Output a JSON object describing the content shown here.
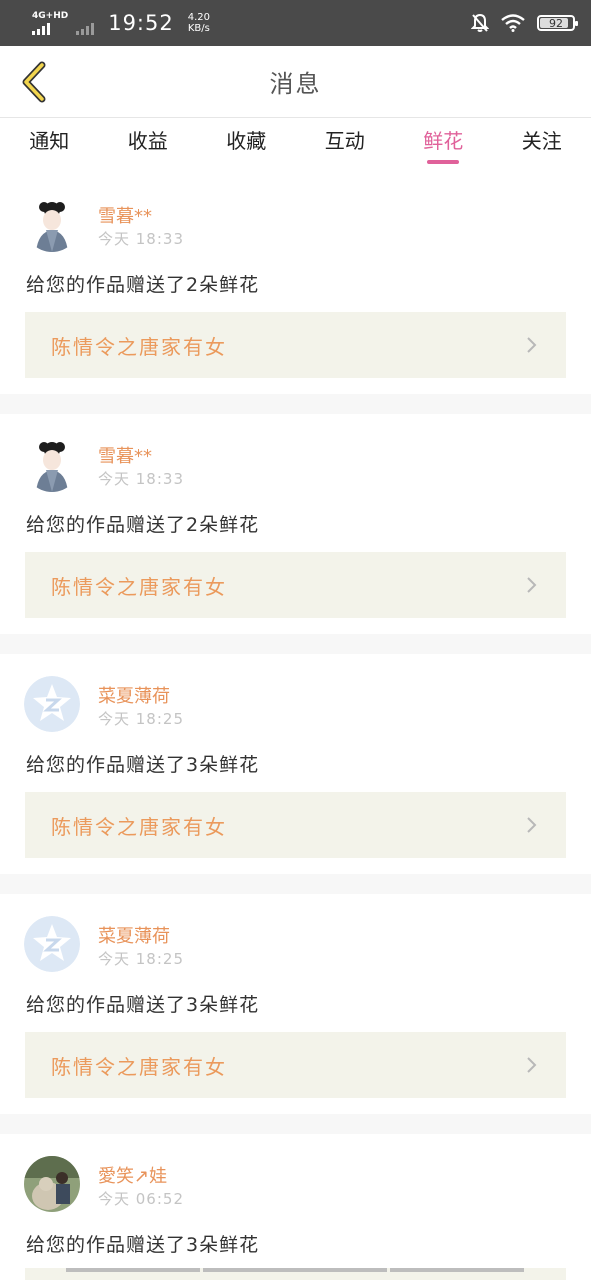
{
  "status_bar": {
    "network": "4G+HD",
    "time": "19:52",
    "speed_value": "4.20",
    "speed_unit": "KB/s",
    "battery": "92"
  },
  "nav": {
    "title": "消息"
  },
  "tabs": [
    {
      "label": "通知"
    },
    {
      "label": "收益"
    },
    {
      "label": "收藏"
    },
    {
      "label": "互动"
    },
    {
      "label": "鲜花",
      "active": true
    },
    {
      "label": "关注"
    }
  ],
  "messages": [
    {
      "user": "雪暮**",
      "time": "今天 18:33",
      "text": "给您的作品赠送了2朵鲜花",
      "work": "陈情令之唐家有女"
    },
    {
      "user": "雪暮**",
      "time": "今天 18:33",
      "text": "给您的作品赠送了2朵鲜花",
      "work": "陈情令之唐家有女"
    },
    {
      "user": "菜夏薄荷",
      "time": "今天 18:25",
      "text": "给您的作品赠送了3朵鲜花",
      "work": "陈情令之唐家有女"
    },
    {
      "user": "菜夏薄荷",
      "time": "今天 18:25",
      "text": "给您的作品赠送了3朵鲜花",
      "work": "陈情令之唐家有女"
    },
    {
      "user": "愛笑↗娃",
      "time": "今天 06:52",
      "text": "给您的作品赠送了3朵鲜花"
    }
  ],
  "colors": {
    "accent": "#e0619a",
    "username": "#e8935a",
    "work_title": "#eb9a5c",
    "work_bg": "#f3f3ea"
  },
  "icons": [
    "back-arrow-icon",
    "bell-off-icon",
    "wifi-icon",
    "battery-icon",
    "chevron-right-icon",
    "qq-default-avatar-icon"
  ]
}
